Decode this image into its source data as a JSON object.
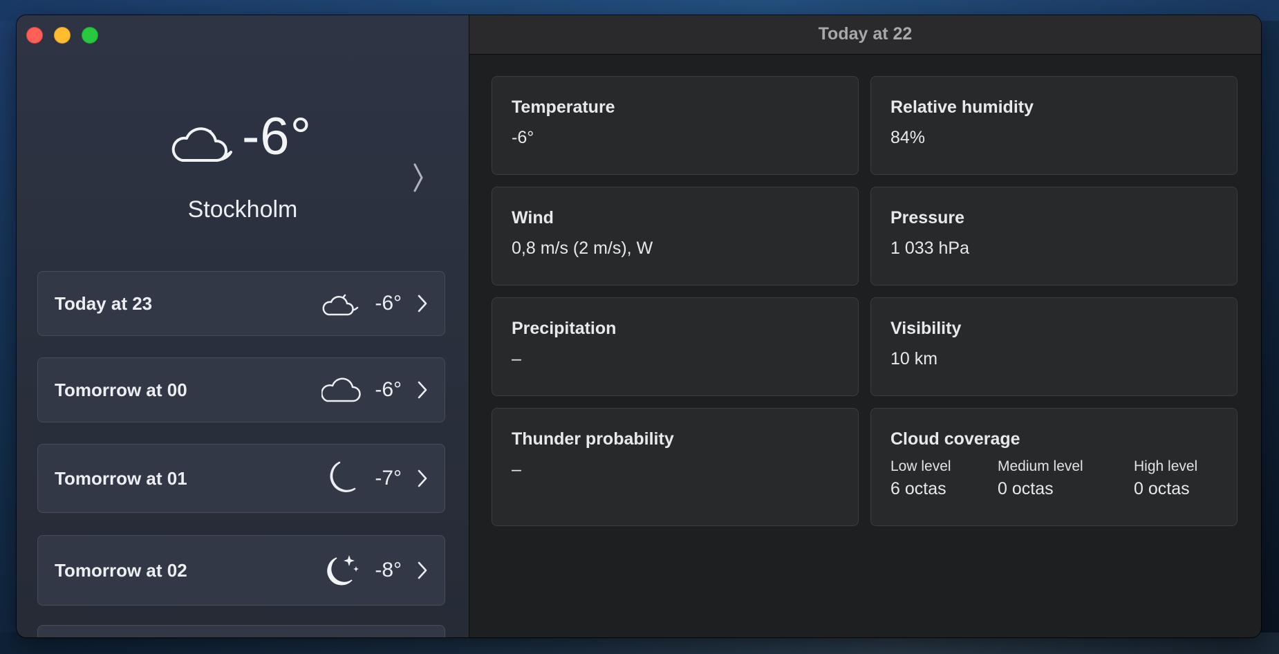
{
  "window": {
    "controls": [
      "close",
      "minimize",
      "zoom"
    ]
  },
  "current": {
    "icon": "cloud-moon-icon",
    "temperature": "-6°",
    "city": "Stockholm"
  },
  "hours": [
    {
      "label": "Today at 23",
      "icon": "cloud-moon-icon",
      "temp": "-6°"
    },
    {
      "label": "Tomorrow at 00",
      "icon": "cloud-icon",
      "temp": "-6°"
    },
    {
      "label": "Tomorrow at 01",
      "icon": "moon-icon",
      "temp": "-7°"
    },
    {
      "label": "Tomorrow at 02",
      "icon": "moon-stars-icon",
      "temp": "-8°"
    }
  ],
  "detail": {
    "title": "Today at 22",
    "temperature": {
      "title": "Temperature",
      "value": "-6°"
    },
    "humidity": {
      "title": "Relative humidity",
      "value": "84%"
    },
    "wind": {
      "title": "Wind",
      "value": "0,8 m/s (2 m/s), W"
    },
    "pressure": {
      "title": "Pressure",
      "value": "1 033 hPa"
    },
    "precipitation": {
      "title": "Precipitation",
      "value": "–"
    },
    "visibility": {
      "title": "Visibility",
      "value": "10 km"
    },
    "thunder": {
      "title": "Thunder probability",
      "value": "–"
    },
    "cloud": {
      "title": "Cloud coverage",
      "low": {
        "label": "Low level",
        "value": "6 octas"
      },
      "medium": {
        "label": "Medium level",
        "value": "0 octas"
      },
      "high": {
        "label": "High level",
        "value": "0 octas"
      }
    }
  },
  "colors": {
    "sidebar": "#2a303d",
    "card": "#28292b",
    "close": "#fe5f57",
    "minimize": "#febc2e",
    "zoom": "#28c840"
  }
}
